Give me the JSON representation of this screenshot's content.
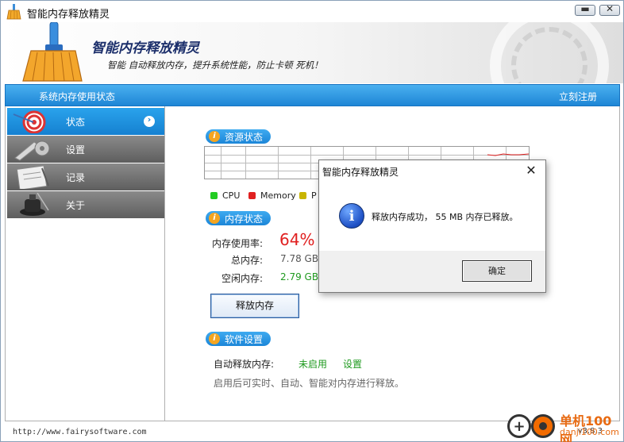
{
  "window": {
    "title": "智能内存释放精灵",
    "minimize_glyph": "▬",
    "close_glyph": "✕"
  },
  "banner": {
    "title": "智能内存释放精灵",
    "subtitle": "智能 自动释放内存，提升系统性能，防止卡顿 死机！"
  },
  "status_header": {
    "left": "系统内存使用状态",
    "right": "立刻注册"
  },
  "sidebar": {
    "items": [
      {
        "label": "状态",
        "icon": "target-icon",
        "active": true
      },
      {
        "label": "设置",
        "icon": "wrench-icon",
        "active": false
      },
      {
        "label": "记录",
        "icon": "clipboard-icon",
        "active": false
      },
      {
        "label": "关于",
        "icon": "ink-bottle-icon",
        "active": false
      }
    ],
    "active_arrow": "›"
  },
  "resource": {
    "section_title": "资源状态",
    "legend": [
      {
        "label": "CPU",
        "color": "#22cc22"
      },
      {
        "label": "Memory",
        "color": "#e02020"
      },
      {
        "label": "P",
        "color": "#c8b400"
      }
    ]
  },
  "memory": {
    "section_title": "内存状态",
    "usage_label": "内存使用率:",
    "usage_value": "64%",
    "total_label": "总内存:",
    "total_value": "7.78 GB",
    "free_label": "空闲内存:",
    "free_value": "2.79 GB",
    "release_button": "释放内存"
  },
  "software": {
    "section_title": "软件设置",
    "auto_label": "自动释放内存:",
    "auto_state": "未启用",
    "settings_link": "设置",
    "description": "启用后可实时、自动、智能对内存进行释放。"
  },
  "footer": {
    "url": "http://www.fairysoftware.com",
    "version": "v3.8.3"
  },
  "watermark": {
    "text1": "单机100网",
    "text2": "danji100.com"
  },
  "dialog": {
    "title": "智能内存释放精灵",
    "close_glyph": "✕",
    "icon_glyph": "i",
    "message": "释放内存成功， 55 MB 内存已释放。",
    "ok_button": "确定"
  },
  "colors": {
    "accent_blue": "#1e86d6",
    "sidebar_gray": "#6e6e6e",
    "usage_red": "#e02020",
    "free_green": "#1f9a1f"
  }
}
